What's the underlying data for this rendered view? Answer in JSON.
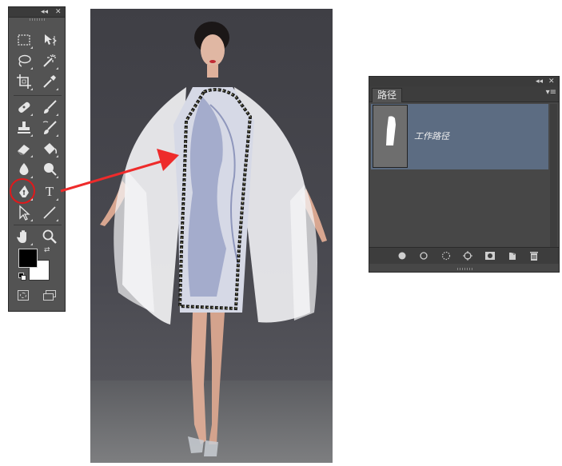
{
  "tools_panel": {
    "collapse_glyph": "◂◂",
    "close_glyph": "✕",
    "tools": [
      {
        "name": "rectangular-marquee-icon"
      },
      {
        "name": "move-icon"
      },
      {
        "name": "lasso-icon"
      },
      {
        "name": "magic-wand-icon"
      },
      {
        "name": "crop-icon"
      },
      {
        "name": "eyedropper-icon"
      },
      {
        "name": "spot-healing-icon"
      },
      {
        "name": "brush-icon"
      },
      {
        "name": "clone-stamp-icon"
      },
      {
        "name": "history-brush-icon"
      },
      {
        "name": "eraser-icon"
      },
      {
        "name": "paint-bucket-icon"
      },
      {
        "name": "blur-icon"
      },
      {
        "name": "dodge-icon"
      },
      {
        "name": "pen-icon"
      },
      {
        "name": "type-icon"
      },
      {
        "name": "path-selection-icon"
      },
      {
        "name": "line-icon"
      },
      {
        "name": "hand-icon"
      },
      {
        "name": "zoom-icon"
      }
    ],
    "type_glyph": "T",
    "swap_glyph": "⇄",
    "foreground_color": "#000000",
    "background_color": "#ffffff",
    "highlight_color": "#e0191b"
  },
  "paths_panel": {
    "collapse_glyph": "◂◂",
    "close_glyph": "✕",
    "menu_glyph": "▾≡",
    "tab_label": "路径",
    "path_name": "工作路径",
    "bottom_buttons": [
      "fill-path-icon",
      "stroke-path-icon",
      "load-selection-icon",
      "make-work-path-icon",
      "add-mask-icon",
      "new-path-icon",
      "delete-path-icon"
    ]
  },
  "colors": {
    "panel_bg": "#535353",
    "panel_dark": "#3b3b3b",
    "selected_row": "#5c6c82",
    "arrow": "#ee2b2b"
  }
}
